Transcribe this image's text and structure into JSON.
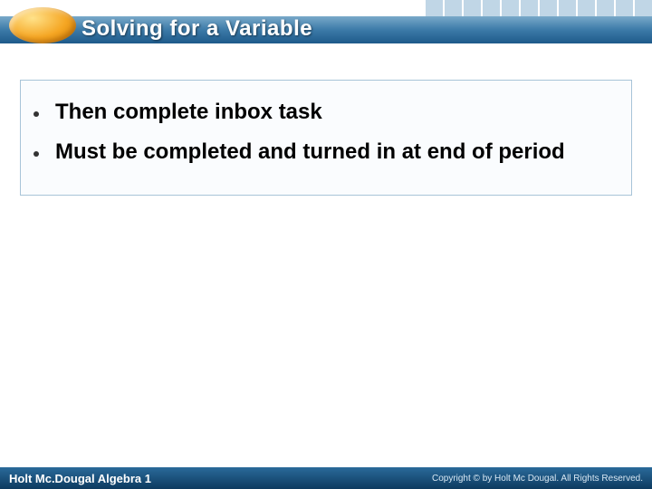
{
  "header": {
    "title": "Solving for a Variable"
  },
  "content": {
    "bullets": [
      "Then complete inbox task",
      "Must be completed and turned in at end of period"
    ]
  },
  "footer": {
    "left": "Holt Mc.Dougal Algebra 1",
    "right": "Copyright © by Holt Mc Dougal. All Rights Reserved."
  }
}
